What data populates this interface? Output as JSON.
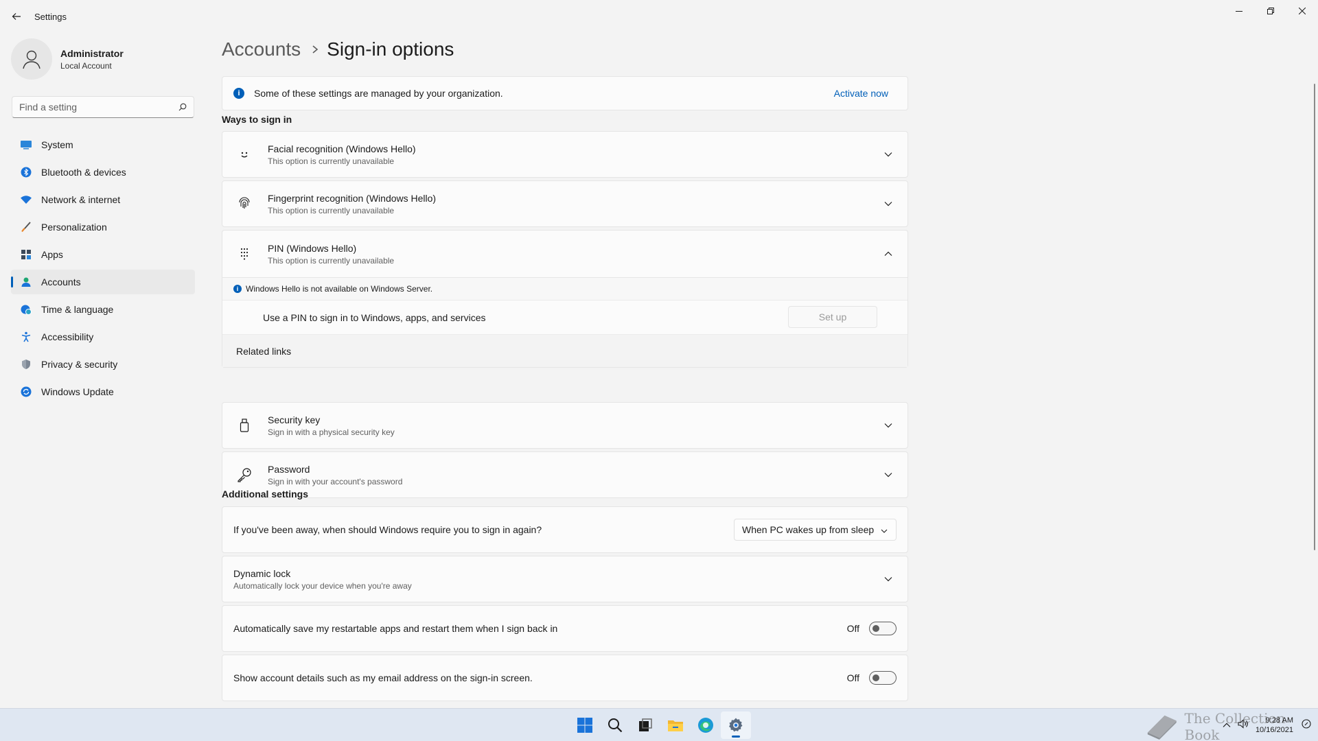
{
  "window": {
    "title": "Settings"
  },
  "profile": {
    "name": "Administrator",
    "account_type": "Local Account"
  },
  "search": {
    "placeholder": "Find a setting"
  },
  "nav": {
    "items": [
      {
        "label": "System",
        "icon": "system-icon",
        "active": false
      },
      {
        "label": "Bluetooth & devices",
        "icon": "bluetooth-icon",
        "active": false
      },
      {
        "label": "Network & internet",
        "icon": "wifi-icon",
        "active": false
      },
      {
        "label": "Personalization",
        "icon": "brush-icon",
        "active": false
      },
      {
        "label": "Apps",
        "icon": "apps-icon",
        "active": false
      },
      {
        "label": "Accounts",
        "icon": "person-icon",
        "active": true
      },
      {
        "label": "Time & language",
        "icon": "globe-clock-icon",
        "active": false
      },
      {
        "label": "Accessibility",
        "icon": "accessibility-icon",
        "active": false
      },
      {
        "label": "Privacy & security",
        "icon": "shield-icon",
        "active": false
      },
      {
        "label": "Windows Update",
        "icon": "update-icon",
        "active": false
      }
    ]
  },
  "breadcrumb": {
    "parent": "Accounts",
    "current": "Sign-in options"
  },
  "info_bar": {
    "text": "Some of these settings are managed by your organization.",
    "link": "Activate now"
  },
  "ways": {
    "heading": "Ways to sign in",
    "facial": {
      "title": "Facial recognition (Windows Hello)",
      "subtitle": "This option is currently unavailable"
    },
    "fingerprint": {
      "title": "Fingerprint recognition (Windows Hello)",
      "subtitle": "This option is currently unavailable"
    },
    "pin": {
      "title": "PIN (Windows Hello)",
      "subtitle": "This option is currently unavailable",
      "note": "Windows Hello is not available on Windows Server.",
      "use_text": "Use a PIN to sign in to Windows, apps, and services",
      "setup_label": "Set up",
      "related": "Related links"
    },
    "security_key": {
      "title": "Security key",
      "subtitle": "Sign in with a physical security key"
    },
    "password": {
      "title": "Password",
      "subtitle": "Sign in with your account's password"
    }
  },
  "additional": {
    "heading": "Additional settings",
    "require_signin": {
      "label": "If you've been away, when should Windows require you to sign in again?",
      "selected": "When PC wakes up from sleep"
    },
    "dynamic_lock": {
      "title": "Dynamic lock",
      "subtitle": "Automatically lock your device when you're away"
    },
    "restart_apps": {
      "label": "Automatically save my restartable apps and restart them when I sign back in",
      "state": "Off"
    },
    "account_details": {
      "label": "Show account details such as my email address on the sign-in screen.",
      "state": "Off"
    }
  },
  "taskbar": {
    "apps": [
      "start-icon",
      "search-icon",
      "task-view-icon",
      "file-explorer-icon",
      "edge-icon",
      "settings-icon"
    ],
    "time": "9:28 AM",
    "date": "10/16/2021",
    "watermark": "The Collection Book"
  },
  "colors": {
    "accent": "#005fb8",
    "background": "#f3f3f3",
    "card": "#fbfbfb"
  }
}
